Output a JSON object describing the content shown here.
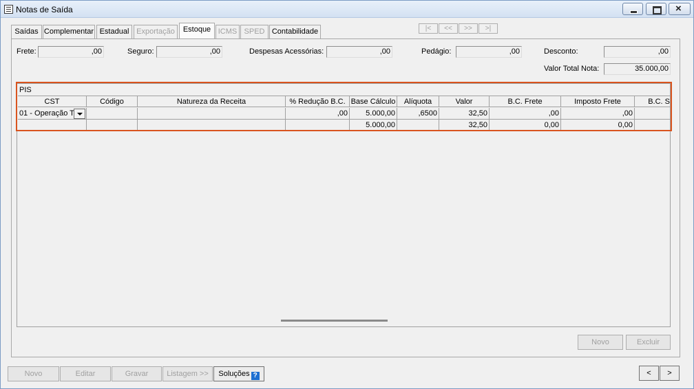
{
  "window": {
    "title": "Notas de Saída"
  },
  "tabs": [
    {
      "label": "Saídas"
    },
    {
      "label": "Complementar"
    },
    {
      "label": "Estadual"
    },
    {
      "label": "Exportação"
    },
    {
      "label": "Estoque"
    },
    {
      "label": "ICMS"
    },
    {
      "label": "SPED"
    },
    {
      "label": "Contabilidade"
    }
  ],
  "nav": {
    "first": "|<",
    "prev": "<<",
    "next": ">>",
    "last": ">|"
  },
  "totals": {
    "frete_label": "Frete:",
    "frete_value": ",00",
    "seguro_label": "Seguro:",
    "seguro_value": ",00",
    "despesas_label": "Despesas Acessórias:",
    "despesas_value": ",00",
    "pedagio_label": "Pedágio:",
    "pedagio_value": ",00",
    "desconto_label": "Desconto:",
    "desconto_value": ",00",
    "valor_total_label": "Valor Total Nota:",
    "valor_total_value": "35.000,00"
  },
  "pis": {
    "title": "PIS",
    "columns": [
      "CST",
      "Código",
      "Natureza da Receita",
      "% Redução B.C.",
      "Base Cálculo",
      "Alíquota",
      "Valor",
      "B.C. Frete",
      "Imposto Frete",
      "B.C. S"
    ],
    "rows": [
      [
        "01 - Operação T",
        "",
        "",
        ",00",
        "5.000,00",
        ",6500",
        "32,50",
        ",00",
        ",00",
        ""
      ]
    ],
    "total_row": [
      "",
      "",
      "",
      "",
      "5.000,00",
      "",
      "32,50",
      "0,00",
      "0,00",
      ""
    ]
  },
  "panel_buttons": {
    "novo": "Novo",
    "excluir": "Excluir"
  },
  "footer_buttons": {
    "novo": "Novo",
    "editar": "Editar",
    "gravar": "Gravar",
    "listagem": "Listagem >>",
    "solucoes": "Soluções",
    "prev": "<",
    "next": ">"
  }
}
